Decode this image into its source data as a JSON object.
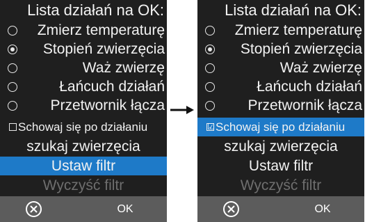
{
  "colors": {
    "panel_bg": "#1f1f1f",
    "text": "#f2f2f2",
    "selection": "#1e7ac8",
    "disabled_text": "#6e6e6e",
    "bottom_bar": "#5c5c5c"
  },
  "left_panel": {
    "title": "Lista działań na OK:",
    "radio_items": [
      {
        "label": "Zmierz temperaturę",
        "checked": false
      },
      {
        "label": "Stopień zwierzęcia",
        "checked": true
      },
      {
        "label": "Waż zwierzę",
        "checked": false
      },
      {
        "label": "Łańcuch działań",
        "checked": false
      },
      {
        "label": "Przetwornik łącza",
        "checked": false
      }
    ],
    "checkbox": {
      "label": "Schowaj się po działaniu",
      "checked": false,
      "glyph": ""
    },
    "search_label": "szukaj zwierzęcia",
    "set_filter_label": "Ustaw filtr",
    "clear_filter_label": "Wyczyść filtr",
    "ok_label": "OK",
    "cancel_icon": "circle-x-icon"
  },
  "right_panel": {
    "title": "Lista działań na OK:",
    "radio_items": [
      {
        "label": "Zmierz temperaturę",
        "checked": false
      },
      {
        "label": "Stopień zwierzęcia",
        "checked": true
      },
      {
        "label": "Waż zwierzę",
        "checked": false
      },
      {
        "label": "Łańcuch działań",
        "checked": false
      },
      {
        "label": "Przetwornik łącza",
        "checked": false
      }
    ],
    "checkbox": {
      "label": "Schowaj się po działaniu",
      "checked": true,
      "glyph": "☑"
    },
    "search_label": "szukaj zwierzęcia",
    "set_filter_label": "Ustaw filtr",
    "clear_filter_label": "Wyczyść filtr",
    "ok_label": "OK",
    "cancel_icon": "circle-x-icon"
  },
  "transition_icon": "arrow-right-icon"
}
